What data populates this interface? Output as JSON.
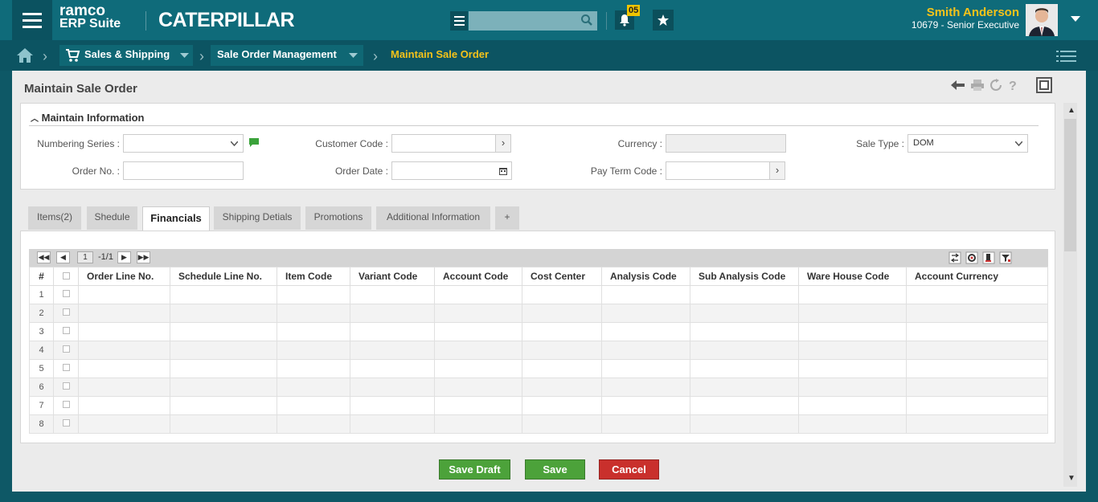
{
  "header": {
    "brand_line1": "ramco",
    "brand_line2": "ERP Suite",
    "company_logo": "CATERPILLAR",
    "search_placeholder": "",
    "notification_count": "05",
    "user_name": "Smith Anderson",
    "user_role": "10679 - Senior Executive",
    "icons": [
      "menu-icon",
      "list-icon",
      "search-icon",
      "bell-icon",
      "star-icon",
      "user-avatar",
      "chevron-down-icon"
    ]
  },
  "breadcrumb": {
    "module": "Sales & Shipping",
    "submodule": "Sale Order Management",
    "current": "Maintain Sale Order"
  },
  "page": {
    "title": "Maintain Sale Order"
  },
  "info_section": {
    "heading": "Maintain Information",
    "fields": {
      "numbering_series_label": "Numbering Series :",
      "numbering_series_value": "",
      "customer_code_label": "Customer Code :",
      "customer_code_value": "",
      "currency_label": "Currency :",
      "currency_value": "",
      "sale_type_label": "Sale Type :",
      "sale_type_value": "DOM",
      "order_no_label": "Order No. :",
      "order_no_value": "",
      "order_date_label": "Order Date :",
      "order_date_value": "",
      "pay_term_code_label": "Pay Term Code :",
      "pay_term_code_value": ""
    }
  },
  "tabs": [
    "Items(2)",
    "Shedule",
    "Financials",
    "Shipping Detials",
    "Promotions",
    "Additional Information",
    "+"
  ],
  "active_tab": "Financials",
  "pager": {
    "page": "1",
    "total": "-1/1"
  },
  "grid": {
    "columns": [
      "#",
      "",
      "Order Line No.",
      "Schedule Line No.",
      "Item Code",
      "Variant Code",
      "Account Code",
      "Cost Center",
      "Analysis Code",
      "Sub Analysis Code",
      "Ware House Code",
      "Account Currency"
    ],
    "rows": [
      "1",
      "2",
      "3",
      "4",
      "5",
      "6",
      "7",
      "8"
    ]
  },
  "buttons": {
    "save_draft": "Save Draft",
    "save": "Save",
    "cancel": "Cancel"
  },
  "colors": {
    "header_bg": "#0f6b7a",
    "nav_bg": "#0c5462",
    "accent_yellow": "#f5c31a",
    "save_green": "#4ca23a",
    "cancel_red": "#c9302c"
  }
}
